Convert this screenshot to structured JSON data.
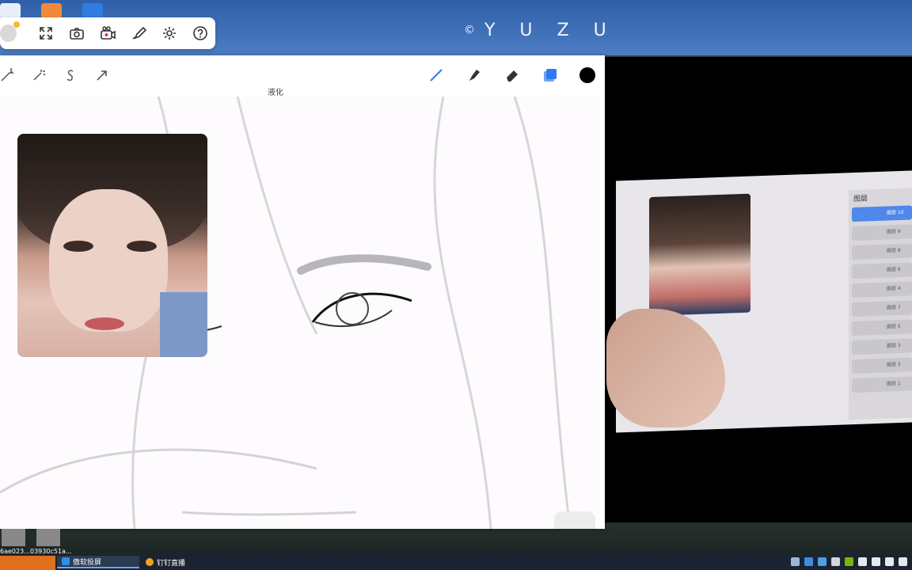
{
  "watermark": {
    "copyright_symbol": "©",
    "text": "Y U Z U"
  },
  "float_toolbar": {
    "buttons": [
      "avatar",
      "fullscreen-icon",
      "screenshot-camera-icon",
      "record-icon",
      "annotate-brush-icon",
      "settings-gear-icon",
      "help-icon"
    ]
  },
  "procreate": {
    "liquify_label": "液化",
    "left_tools": [
      "wrench-icon",
      "magic-wand-icon",
      "selection-s-icon",
      "transform-arrow-icon"
    ],
    "right_tools": [
      "brush-icon",
      "smudge-icon",
      "eraser-icon",
      "layers-icon",
      "color-swatch"
    ],
    "accent_color": "#2f7bf0",
    "color_swatch": "#000000"
  },
  "video_panel": {
    "layers_title": "图层",
    "layer_rows": [
      "图层 10",
      "图层 9",
      "图层 8",
      "图层 6",
      "图层 4",
      "图层 7",
      "图层 5",
      "图层 3",
      "图层 2",
      "图层 1"
    ]
  },
  "desktop_files": [
    {
      "label": "6ae023..."
    },
    {
      "label": "03930c51a..."
    }
  ],
  "taskbar": {
    "items": [
      {
        "label": "傲软投屏",
        "color": "#2f8fe8"
      },
      {
        "label": "钉钉直播",
        "color": "#f0a21e"
      }
    ],
    "tray_icons": [
      "network-share-icon",
      "app-tray-icon",
      "shield-tray-icon",
      "usb-icon",
      "nvidia-icon",
      "wifi-icon",
      "display-icon",
      "volume-icon",
      "pen-icon"
    ]
  }
}
